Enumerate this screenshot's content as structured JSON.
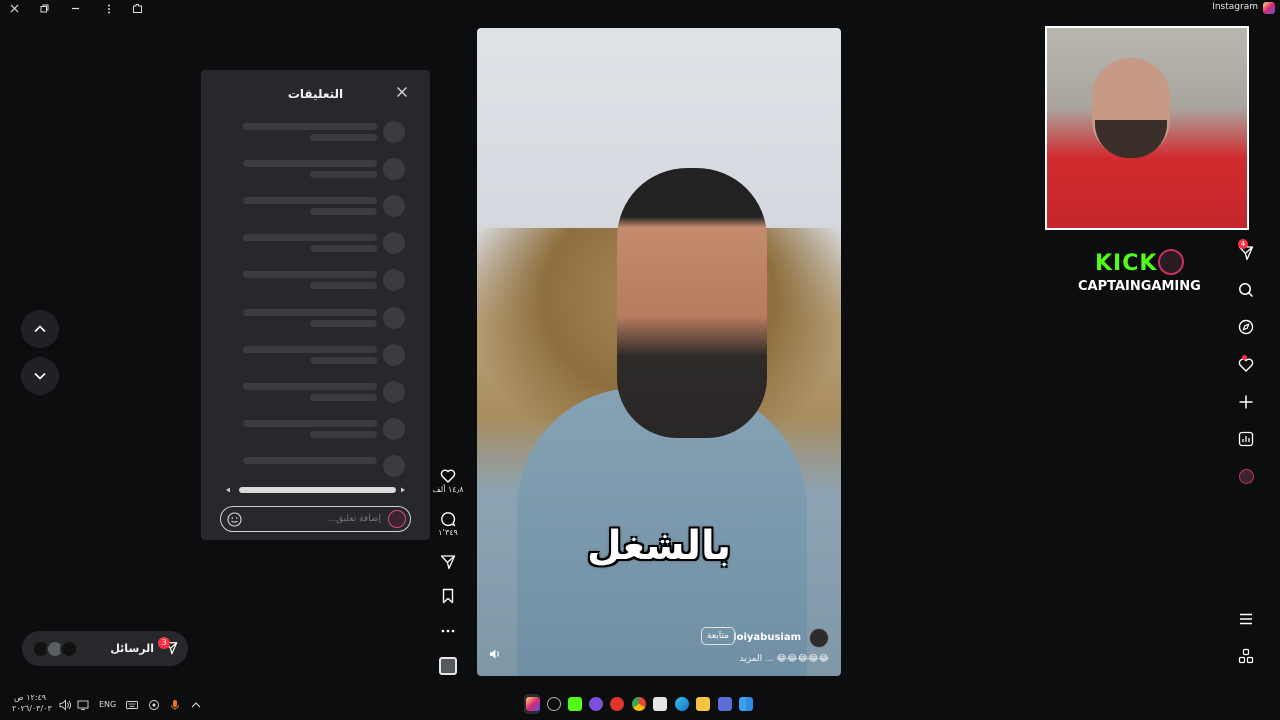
{
  "window": {
    "title": "Instagram"
  },
  "comments": {
    "title": "التعليقات",
    "input_placeholder": "إضافة تعليق..."
  },
  "actions": {
    "likes": "١٤٫٨ ألف",
    "comments_count": "١٬٣٤٩"
  },
  "video": {
    "subtitle": "بالشغل",
    "username": "loiyabusiam",
    "follow_label": "متابعة",
    "caption": "😂😂😂😂😂 ... المزيد"
  },
  "overlay": {
    "kick_logo": "KICK",
    "channel": "CAPTAINGAMING"
  },
  "nav": {
    "messages_badge": "4"
  },
  "messages": {
    "label": "الرسائل",
    "badge": "3"
  },
  "taskbar": {
    "time": "١٢:٤٩ ص",
    "date": "٢٠٢٦/٠٣/٠٣",
    "language": "ENG"
  },
  "colors": {
    "background": "#0c0d0f",
    "panel": "#26282b",
    "kick_green": "#53fc18",
    "notification_red": "#ff3040"
  }
}
